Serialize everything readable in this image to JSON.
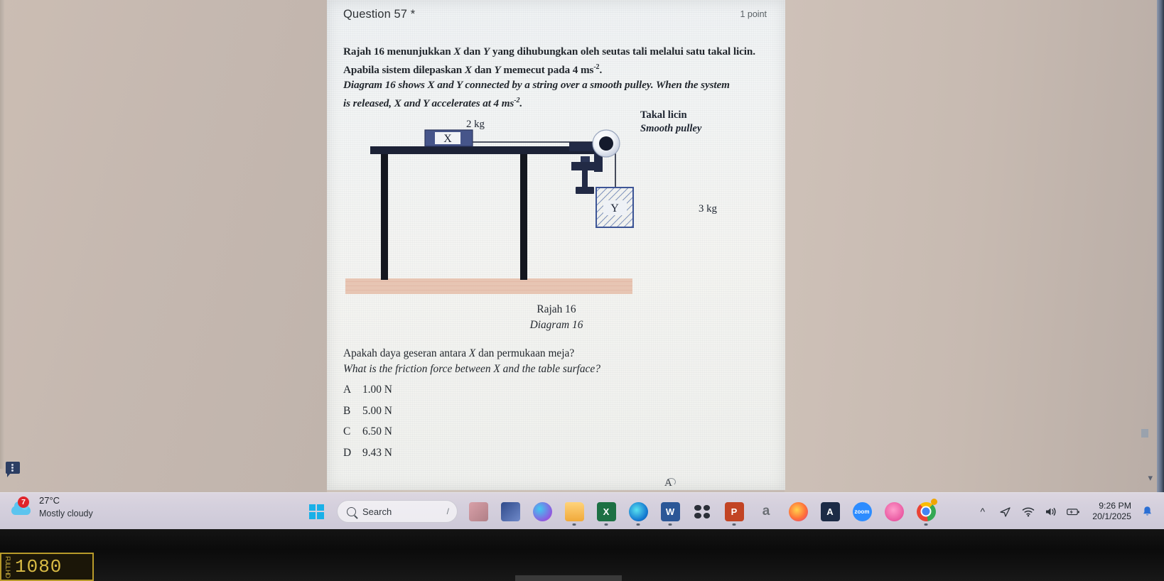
{
  "question": {
    "title": "Question 57 *",
    "points": "1 point",
    "stem": [
      {
        "text": "Rajah 16 menunjukkan X dan Y yang dihubungkan oleh seutas tali melalui satu takal licin.",
        "style": "bold"
      },
      {
        "text": "Apabila sistem dilepaskan X dan Y memecut pada 4 ms-2.",
        "style": "bold"
      },
      {
        "text": "Diagram 16 shows X and Y connected by a string over a smooth pulley. When the system",
        "style": "bold-italic"
      },
      {
        "text": "is released, X and Y accelerates at 4 ms-2.",
        "style": "bold-italic"
      }
    ],
    "prompt_malay": "Apakah daya geseran antara X dan permukaan meja?",
    "prompt_english": "What is the friction force between X and the table surface?",
    "options": [
      {
        "letter": "A",
        "text": "1.00 N"
      },
      {
        "letter": "B",
        "text": "5.00 N"
      },
      {
        "letter": "C",
        "text": "6.50 N"
      },
      {
        "letter": "D",
        "text": "9.43 N"
      }
    ],
    "partial_next_option": "A"
  },
  "diagram": {
    "caption_malay": "Rajah 16",
    "caption_english": "Diagram 16",
    "labels": {
      "pulley_malay": "Takal licin",
      "pulley_english": "Smooth pulley",
      "block_x_mass": "2 kg",
      "block_x_name": "X",
      "block_y_mass": "3 kg",
      "block_y_name": "Y"
    },
    "colors": {
      "table": "#1f2438",
      "block": "#3a4a72",
      "floor": "#e6c2b0",
      "string": "#1f2438"
    }
  },
  "taskbar": {
    "weather": {
      "temperature": "27°C",
      "condition": "Mostly cloudy",
      "badge_count": "7",
      "icon": "cloud-icon"
    },
    "start": {
      "label": "Start",
      "icon": "windows-logo-icon"
    },
    "search": {
      "placeholder": "Search",
      "icon": "search-icon",
      "caret": "/"
    },
    "pinned": [
      {
        "name": "weather-app",
        "icon": "weather-app-icon",
        "class": "ic-weatherapp",
        "glyph": "",
        "running": false
      },
      {
        "name": "widgets",
        "icon": "widgets-icon",
        "class": "ic-widgets",
        "glyph": "",
        "running": false
      },
      {
        "name": "copilot",
        "icon": "copilot-icon",
        "class": "ic-copilot",
        "glyph": "",
        "running": false
      },
      {
        "name": "file-explorer",
        "icon": "folder-icon",
        "class": "ic-explorer",
        "glyph": "",
        "running": true
      },
      {
        "name": "excel",
        "icon": "excel-icon",
        "class": "ic-excel",
        "glyph": "X",
        "running": true
      },
      {
        "name": "edge",
        "icon": "edge-icon",
        "class": "ic-edge",
        "glyph": "",
        "running": true
      },
      {
        "name": "word",
        "icon": "word-icon",
        "class": "ic-word",
        "glyph": "W",
        "running": true
      },
      {
        "name": "teams",
        "icon": "teams-icon",
        "class": "ic-teams",
        "glyph": "",
        "running": false
      },
      {
        "name": "powerpoint",
        "icon": "powerpoint-icon",
        "class": "ic-ppt",
        "glyph": "P",
        "running": true
      },
      {
        "name": "amazon",
        "icon": "amazon-icon",
        "class": "ic-amazon",
        "glyph": "a",
        "running": false
      },
      {
        "name": "firefox",
        "icon": "firefox-icon",
        "class": "ic-firefox",
        "glyph": "",
        "running": false
      },
      {
        "name": "adobe",
        "icon": "adobe-icon",
        "class": "ic-adobe",
        "glyph": "A",
        "running": false
      },
      {
        "name": "zoom",
        "icon": "zoom-icon",
        "class": "ic-zoom",
        "glyph": "zoom",
        "running": false
      },
      {
        "name": "pink-app",
        "icon": "pink-circle-icon",
        "class": "ic-pink",
        "glyph": "",
        "running": false
      },
      {
        "name": "chrome",
        "icon": "chrome-icon",
        "class": "ic-chrome",
        "glyph": "",
        "running": true
      }
    ],
    "tray": {
      "overflow": "^",
      "icons": [
        {
          "name": "send-icon",
          "glyph": "◁"
        },
        {
          "name": "wifi-icon",
          "glyph": "▰"
        },
        {
          "name": "speaker-icon",
          "glyph": "◁)"
        },
        {
          "name": "battery-icon",
          "glyph": "▭"
        }
      ],
      "time": "9:26 PM",
      "date": "20/1/2025",
      "notification_icon": "bell-icon"
    }
  },
  "monitor": {
    "osd_label": "FULL HD",
    "osd_resolution": "1080"
  },
  "desktop": {
    "chat_icon": "chat-bubble-icon"
  }
}
